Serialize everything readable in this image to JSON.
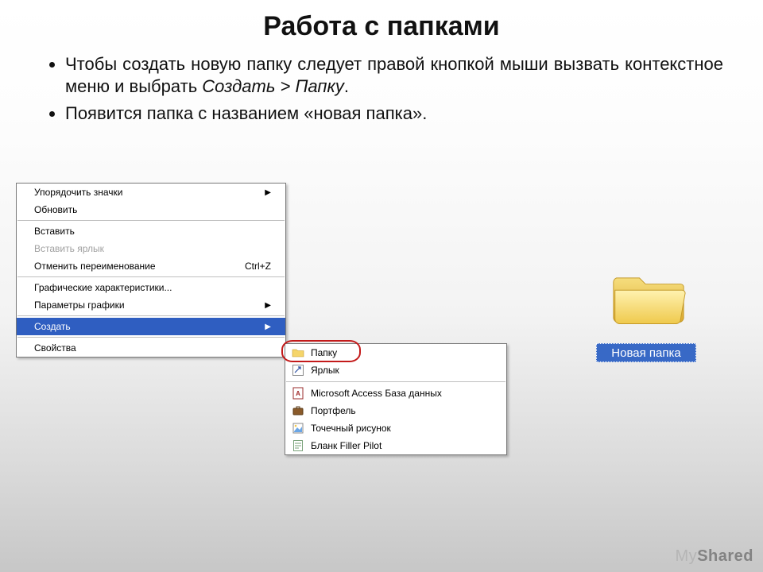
{
  "title": "Работа с папками",
  "bullets": {
    "b1_pre": "Чтобы создать новую папку следует правой кнопкой мыши вызвать контекстное меню и выбрать ",
    "b1_em": "Создать > Папку",
    "b1_post": ".",
    "b2": "Появится папка с названием «новая папка»."
  },
  "menu": {
    "arrange": "Упорядочить значки",
    "refresh": "Обновить",
    "paste": "Вставить",
    "paste_shortcut_label": "Вставить ярлык",
    "undo_rename": "Отменить переименование",
    "undo_rename_shortcut": "Ctrl+Z",
    "gfx_char": "Графические характеристики...",
    "gfx_params": "Параметры графики",
    "create": "Создать",
    "properties": "Свойства"
  },
  "submenu": {
    "folder": "Папку",
    "shortcut": "Ярлык",
    "access": "Microsoft Access База данных",
    "briefcase": "Портфель",
    "bitmap": "Точечный рисунок",
    "filler": "Бланк Filler Pilot"
  },
  "folder_label": "Новая папка",
  "watermark_my": "My",
  "watermark_shared": "Shared"
}
